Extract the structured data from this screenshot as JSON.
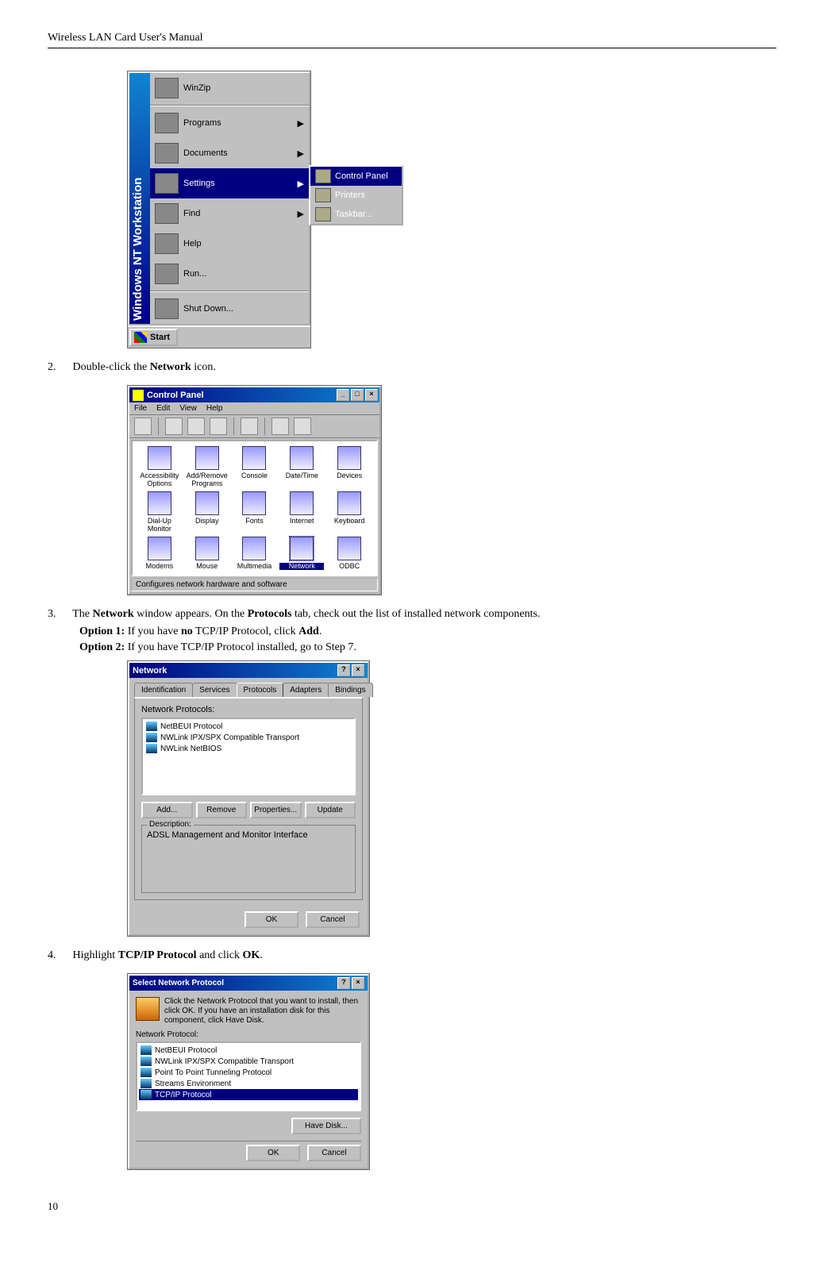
{
  "doc": {
    "header": "Wireless LAN Card User's Manual",
    "page_number": "10"
  },
  "steps": {
    "s2_num": "2.",
    "s2_before": "Double-click the ",
    "s2_bold": "Network",
    "s2_after": " icon.",
    "s3_num": "3.",
    "s3_before": "The ",
    "s3_bold1": "Network",
    "s3_mid": " window appears. On the ",
    "s3_bold2": "Protocols",
    "s3_after": " tab, check out the list of installed network components.",
    "opt1_bold": "Option 1:",
    "opt1_a": " If you have ",
    "opt1_no": "no",
    "opt1_b": " TCP/IP Protocol, click ",
    "opt1_add": "Add",
    "opt1_c": ".",
    "opt2_bold": "Option 2:",
    "opt2_text": " If you have TCP/IP Protocol installed, go to Step 7.",
    "s4_num": "4.",
    "s4_before": "Highlight ",
    "s4_bold1": "TCP/IP Protocol",
    "s4_mid": " and click ",
    "s4_bold2": "OK",
    "s4_after": "."
  },
  "startmenu": {
    "side_label": "Windows NT Workstation",
    "items": {
      "winzip": "WinZip",
      "programs": "Programs",
      "documents": "Documents",
      "settings": "Settings",
      "find": "Find",
      "help": "Help",
      "run": "Run...",
      "shutdown": "Shut Down..."
    },
    "flyout": {
      "control_panel": "Control Panel",
      "printers": "Printers",
      "taskbar": "Taskbar..."
    },
    "start_label": "Start",
    "arrow": "▶"
  },
  "control_panel": {
    "title": "Control Panel",
    "menu": {
      "file": "File",
      "edit": "Edit",
      "view": "View",
      "help": "Help"
    },
    "items": {
      "accessibility": "Accessibility Options",
      "addremove": "Add/Remove Programs",
      "console": "Console",
      "datetime": "Date/Time",
      "devices": "Devices",
      "dialup": "Dial-Up Monitor",
      "display": "Display",
      "fonts": "Fonts",
      "internet": "Internet",
      "keyboard": "Keyboard",
      "modems": "Modems",
      "mouse": "Mouse",
      "multimedia": "Multimedia",
      "network": "Network",
      "odbc": "ODBC"
    },
    "status": "Configures network hardware and software"
  },
  "network_dialog": {
    "title": "Network",
    "tabs": {
      "identification": "Identification",
      "services": "Services",
      "protocols": "Protocols",
      "adapters": "Adapters",
      "bindings": "Bindings"
    },
    "label_protocols": "Network Protocols:",
    "list": {
      "p1": "NetBEUI Protocol",
      "p2": "NWLink IPX/SPX Compatible Transport",
      "p3": "NWLink NetBIOS"
    },
    "buttons": {
      "add": "Add...",
      "remove": "Remove",
      "properties": "Properties...",
      "update": "Update"
    },
    "group_label": "Description:",
    "description": "ADSL Management and Monitor Interface",
    "ok": "OK",
    "cancel": "Cancel",
    "qmark": "?",
    "x": "×"
  },
  "select_protocol": {
    "title": "Select Network Protocol",
    "desc": "Click the Network Protocol that you want to install, then click OK. If you have an installation disk for this component, click Have Disk.",
    "label": "Network Protocol:",
    "list": {
      "p1": "NetBEUI Protocol",
      "p2": "NWLink IPX/SPX Compatible Transport",
      "p3": "Point To Point Tunneling Protocol",
      "p4": "Streams Environment",
      "p5": "TCP/IP Protocol"
    },
    "have_disk": "Have Disk...",
    "ok": "OK",
    "cancel": "Cancel",
    "qmark": "?",
    "x": "×"
  }
}
